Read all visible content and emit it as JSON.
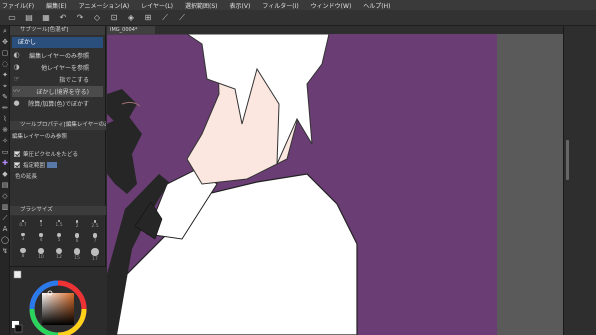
{
  "menu": {
    "items": [
      "ファイル(F)",
      "編集(E)",
      "アニメーション(A)",
      "レイヤー(L)",
      "選択範囲(S)",
      "表示(V)",
      "フィルター(I)",
      "ウィンドウ(W)",
      "ヘルプ(H)"
    ]
  },
  "document": {
    "tab_label": "IMG_0004*"
  },
  "subtool": {
    "panel_header": "サブツール[色混ぜ]",
    "active_tab": "ぼかし",
    "items": [
      {
        "label": "ぼかし",
        "icon": "blur-icon"
      },
      {
        "label": "編集レイヤーのみ参照",
        "icon": "layer-ref-icon"
      },
      {
        "label": "他レイヤーを参照",
        "icon": "other-layer-icon"
      },
      {
        "label": "指でこする",
        "icon": "finger-icon"
      },
      {
        "label": "ぼかし(境界を守る)",
        "icon": "brush-stroke-icon"
      },
      {
        "label": "除算/加算(色)でぼかす",
        "icon": "dark-blur-icon"
      }
    ]
  },
  "tool_property": {
    "header": "ツールプロパティ[編集レイヤーのみ参照]",
    "title": "編集レイヤーのみ参照",
    "options": [
      "筆圧ピクセルをたどる",
      "指定範囲"
    ],
    "value_label": "色の延長"
  },
  "brush_size": {
    "header": "ブラシサイズ",
    "sizes": [
      "0.7",
      "1",
      "1.5",
      "2",
      "2.5",
      "3",
      "4",
      "5",
      "6",
      "7",
      "8",
      "10",
      "12",
      "15",
      "17",
      "20",
      "25",
      "30",
      "40",
      "50"
    ]
  },
  "colors": {
    "canvas_bg": "#6a3e74",
    "skin": "#fbe7e0",
    "hair": "#ffffff",
    "glove": "#262626",
    "accent": "#b48cff",
    "panel_bg": "#303030",
    "selected_tab": "#2a4f7d"
  }
}
